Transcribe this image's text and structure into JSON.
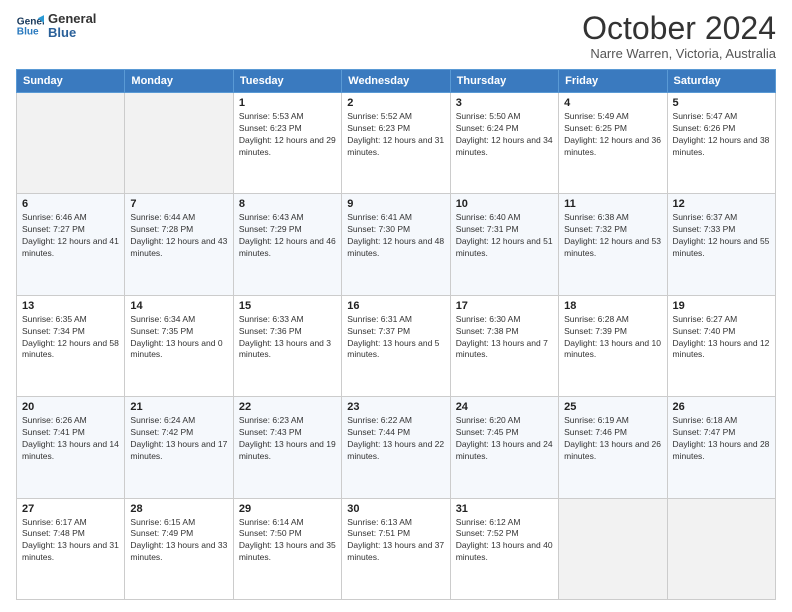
{
  "header": {
    "logo_line1": "General",
    "logo_line2": "Blue",
    "month": "October 2024",
    "location": "Narre Warren, Victoria, Australia"
  },
  "days_of_week": [
    "Sunday",
    "Monday",
    "Tuesday",
    "Wednesday",
    "Thursday",
    "Friday",
    "Saturday"
  ],
  "weeks": [
    [
      null,
      null,
      {
        "day": 1,
        "sunrise": "5:53 AM",
        "sunset": "6:23 PM",
        "daylight": "12 hours and 29 minutes."
      },
      {
        "day": 2,
        "sunrise": "5:52 AM",
        "sunset": "6:23 PM",
        "daylight": "12 hours and 31 minutes."
      },
      {
        "day": 3,
        "sunrise": "5:50 AM",
        "sunset": "6:24 PM",
        "daylight": "12 hours and 34 minutes."
      },
      {
        "day": 4,
        "sunrise": "5:49 AM",
        "sunset": "6:25 PM",
        "daylight": "12 hours and 36 minutes."
      },
      {
        "day": 5,
        "sunrise": "5:47 AM",
        "sunset": "6:26 PM",
        "daylight": "12 hours and 38 minutes."
      }
    ],
    [
      {
        "day": 6,
        "sunrise": "6:46 AM",
        "sunset": "7:27 PM",
        "daylight": "12 hours and 41 minutes."
      },
      {
        "day": 7,
        "sunrise": "6:44 AM",
        "sunset": "7:28 PM",
        "daylight": "12 hours and 43 minutes."
      },
      {
        "day": 8,
        "sunrise": "6:43 AM",
        "sunset": "7:29 PM",
        "daylight": "12 hours and 46 minutes."
      },
      {
        "day": 9,
        "sunrise": "6:41 AM",
        "sunset": "7:30 PM",
        "daylight": "12 hours and 48 minutes."
      },
      {
        "day": 10,
        "sunrise": "6:40 AM",
        "sunset": "7:31 PM",
        "daylight": "12 hours and 51 minutes."
      },
      {
        "day": 11,
        "sunrise": "6:38 AM",
        "sunset": "7:32 PM",
        "daylight": "12 hours and 53 minutes."
      },
      {
        "day": 12,
        "sunrise": "6:37 AM",
        "sunset": "7:33 PM",
        "daylight": "12 hours and 55 minutes."
      }
    ],
    [
      {
        "day": 13,
        "sunrise": "6:35 AM",
        "sunset": "7:34 PM",
        "daylight": "12 hours and 58 minutes."
      },
      {
        "day": 14,
        "sunrise": "6:34 AM",
        "sunset": "7:35 PM",
        "daylight": "13 hours and 0 minutes."
      },
      {
        "day": 15,
        "sunrise": "6:33 AM",
        "sunset": "7:36 PM",
        "daylight": "13 hours and 3 minutes."
      },
      {
        "day": 16,
        "sunrise": "6:31 AM",
        "sunset": "7:37 PM",
        "daylight": "13 hours and 5 minutes."
      },
      {
        "day": 17,
        "sunrise": "6:30 AM",
        "sunset": "7:38 PM",
        "daylight": "13 hours and 7 minutes."
      },
      {
        "day": 18,
        "sunrise": "6:28 AM",
        "sunset": "7:39 PM",
        "daylight": "13 hours and 10 minutes."
      },
      {
        "day": 19,
        "sunrise": "6:27 AM",
        "sunset": "7:40 PM",
        "daylight": "13 hours and 12 minutes."
      }
    ],
    [
      {
        "day": 20,
        "sunrise": "6:26 AM",
        "sunset": "7:41 PM",
        "daylight": "13 hours and 14 minutes."
      },
      {
        "day": 21,
        "sunrise": "6:24 AM",
        "sunset": "7:42 PM",
        "daylight": "13 hours and 17 minutes."
      },
      {
        "day": 22,
        "sunrise": "6:23 AM",
        "sunset": "7:43 PM",
        "daylight": "13 hours and 19 minutes."
      },
      {
        "day": 23,
        "sunrise": "6:22 AM",
        "sunset": "7:44 PM",
        "daylight": "13 hours and 22 minutes."
      },
      {
        "day": 24,
        "sunrise": "6:20 AM",
        "sunset": "7:45 PM",
        "daylight": "13 hours and 24 minutes."
      },
      {
        "day": 25,
        "sunrise": "6:19 AM",
        "sunset": "7:46 PM",
        "daylight": "13 hours and 26 minutes."
      },
      {
        "day": 26,
        "sunrise": "6:18 AM",
        "sunset": "7:47 PM",
        "daylight": "13 hours and 28 minutes."
      }
    ],
    [
      {
        "day": 27,
        "sunrise": "6:17 AM",
        "sunset": "7:48 PM",
        "daylight": "13 hours and 31 minutes."
      },
      {
        "day": 28,
        "sunrise": "6:15 AM",
        "sunset": "7:49 PM",
        "daylight": "13 hours and 33 minutes."
      },
      {
        "day": 29,
        "sunrise": "6:14 AM",
        "sunset": "7:50 PM",
        "daylight": "13 hours and 35 minutes."
      },
      {
        "day": 30,
        "sunrise": "6:13 AM",
        "sunset": "7:51 PM",
        "daylight": "13 hours and 37 minutes."
      },
      {
        "day": 31,
        "sunrise": "6:12 AM",
        "sunset": "7:52 PM",
        "daylight": "13 hours and 40 minutes."
      },
      null,
      null
    ]
  ],
  "labels": {
    "sunrise": "Sunrise:",
    "sunset": "Sunset:",
    "daylight": "Daylight:"
  }
}
